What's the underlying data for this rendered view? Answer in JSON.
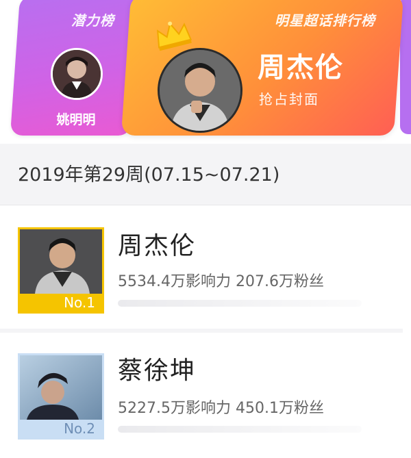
{
  "banner": {
    "potential_tag": "潜力榜",
    "star_tag": "明星超话排行榜",
    "potential_name": "姚明明",
    "top_name": "周杰伦",
    "top_subtitle": "抢占封面"
  },
  "week": "2019年第29周(07.15~07.21)",
  "ranking": [
    {
      "rank": "No.1",
      "name": "周杰伦",
      "stats": "5534.4万影响力 207.6万粉丝"
    },
    {
      "rank": "No.2",
      "name": "蔡徐坤",
      "stats": "5227.5万影响力 450.1万粉丝"
    }
  ],
  "colors": {
    "gold": "#f5c400",
    "silver_blue": "#c9def4",
    "orange_card": "#ff8f3a",
    "purple_card": "#cf63e6"
  },
  "icons": [
    "crown-icon"
  ]
}
